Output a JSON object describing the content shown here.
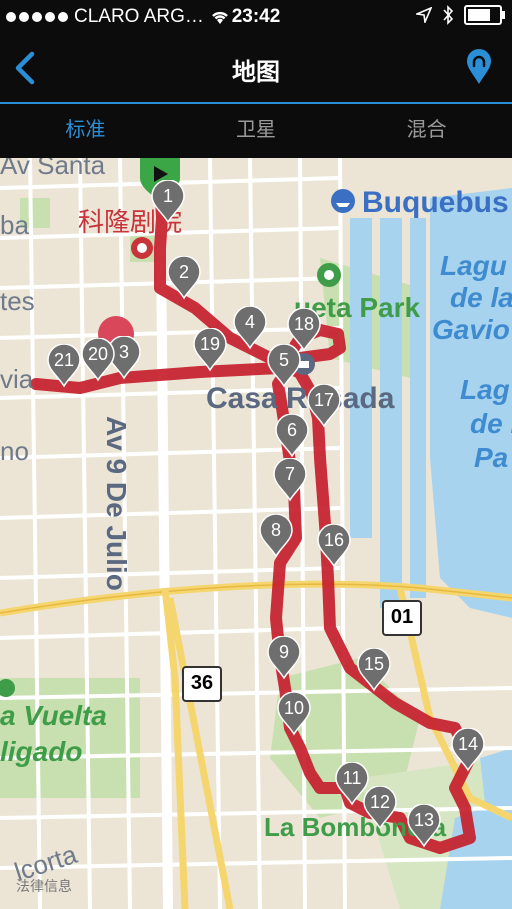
{
  "status_bar": {
    "carrier": "CLARO ARG…",
    "time": "23:42"
  },
  "nav": {
    "title": "地图",
    "back_icon": "chevron-left-icon",
    "right_icon": "map-pin-icon"
  },
  "tabs": [
    {
      "label": "标准",
      "active": true
    },
    {
      "label": "卫星",
      "active": false
    },
    {
      "label": "混合",
      "active": false
    }
  ],
  "map": {
    "labels": {
      "av_santa": "Av Santa",
      "colon_theatre": "科隆剧院",
      "buquebus": "Buquebus",
      "puerto_park": "ueta Park",
      "casa_rosada": "Casa Rosada",
      "av9": "Av 9 De Julio",
      "laguna1": "Lagu",
      "laguna2": "de la",
      "laguna3": "Gavio",
      "laguna4": "Lag",
      "laguna5": "de l",
      "laguna6": "Pa",
      "la_vuelta1": "a Vuelta",
      "la_vuelta2": "ligado",
      "la_bombonera": "La Bombonera",
      "alcorta": "lcorta",
      "left_ba": "ba",
      "left_tes": "tes",
      "left_via": "via",
      "left_no": "no",
      "legal": "法律信息",
      "route_shield_1": "01",
      "route_shield_2": "36"
    },
    "markers": [
      "1",
      "2",
      "3",
      "4",
      "5",
      "6",
      "7",
      "8",
      "9",
      "10",
      "11",
      "12",
      "13",
      "14",
      "15",
      "16",
      "17",
      "18",
      "19",
      "20",
      "21"
    ]
  }
}
